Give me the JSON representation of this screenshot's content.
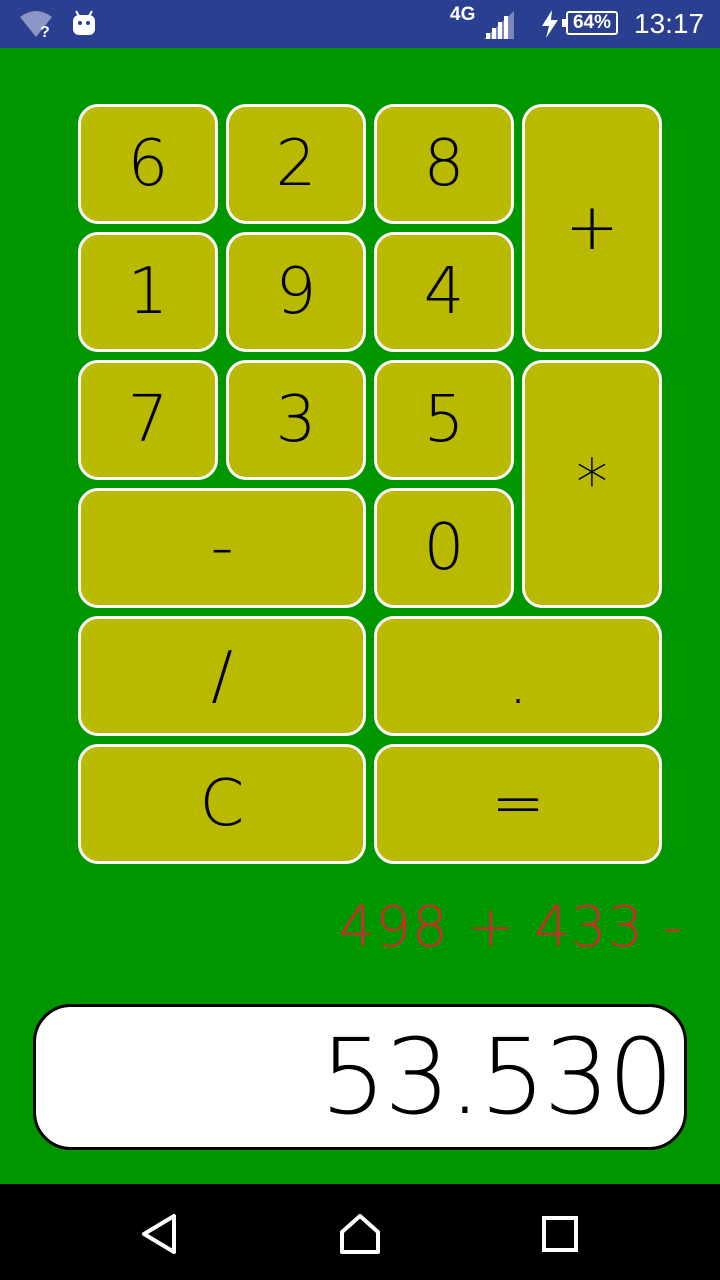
{
  "status_bar": {
    "network_type": "4G",
    "battery": "64%",
    "time": "13:17",
    "icons": [
      "wifi-unknown-icon",
      "android-icon",
      "signal-icon",
      "charging-bolt-icon",
      "battery-icon"
    ]
  },
  "keys": {
    "k6": "6",
    "k2": "2",
    "k8": "8",
    "plus": "+",
    "k1": "1",
    "k9": "9",
    "k4": "4",
    "k7": "7",
    "k3": "3",
    "k5": "5",
    "multiply": "*",
    "minus": "-",
    "k0": "0",
    "divide": "/",
    "dot": ".",
    "clear": "C",
    "equals": "="
  },
  "expression": "498 + 433 -",
  "display_value": "53.530",
  "colors": {
    "background": "#009600",
    "key_fill": "#b9b900",
    "key_border": "#ffffff",
    "expression_text": "#d22a2a",
    "status_bar": "#2a3f8f"
  },
  "nav_bar": {
    "icons": [
      "back-icon",
      "home-icon",
      "recent-apps-icon"
    ]
  }
}
